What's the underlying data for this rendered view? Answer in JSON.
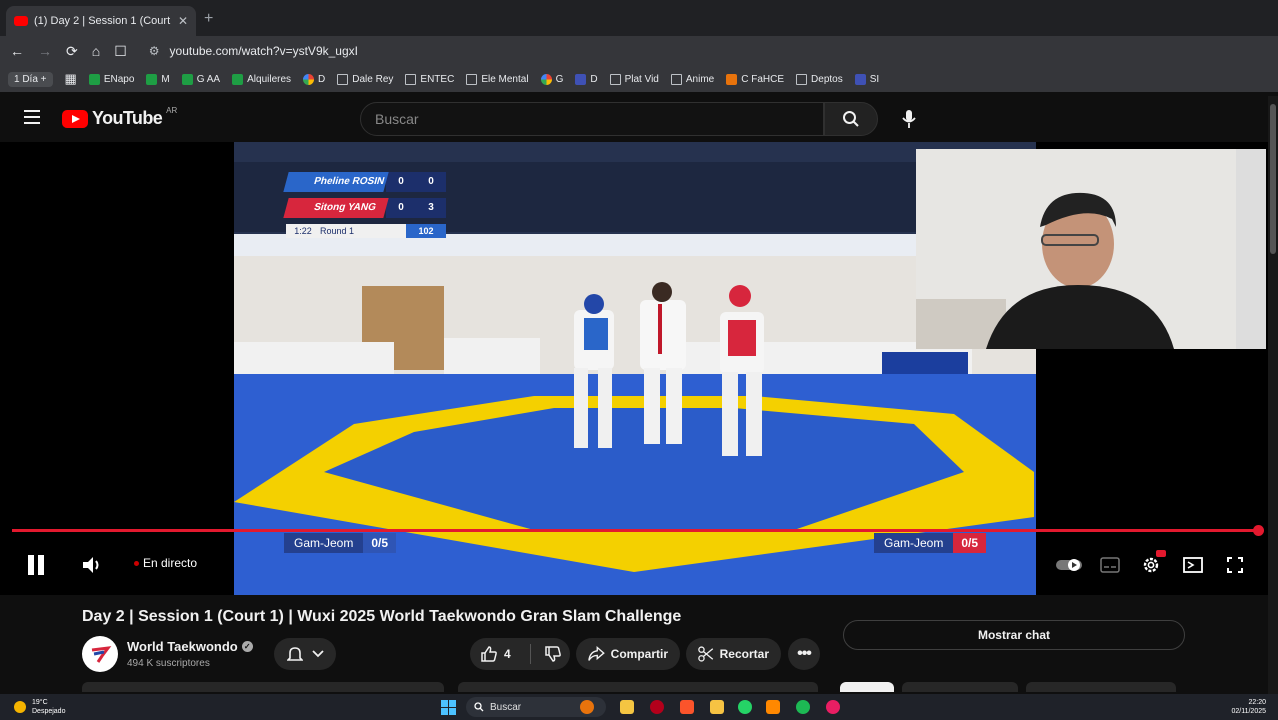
{
  "browser": {
    "tab_title": "(1) Day 2 | Session 1 (Court 1",
    "url": "youtube.com/watch?v=ystV9k_ugxI",
    "bookmarks": [
      "1 Día +",
      "ENapo",
      "M",
      "G AA",
      "Alquileres",
      "D",
      "Dale Rey",
      "ENTEC",
      "Ele Mental",
      "G",
      "D",
      "Plat Vid",
      "Anime",
      "C FaHCE",
      "Deptos",
      "SI"
    ]
  },
  "header": {
    "logo": "YouTube",
    "country": "AR",
    "search_placeholder": "Buscar"
  },
  "player": {
    "scoreboard": {
      "blue_name": "Pheline ROSIN",
      "blue_round_score": "0",
      "blue_score": "0",
      "red_name": "Sitong YANG",
      "red_round_score": "0",
      "red_score": "3",
      "time": "1:22",
      "round_label": "Round",
      "round_num": "1",
      "match_num": "102"
    },
    "gamjeom_left_label": "Gam-Jeom",
    "gamjeom_left_value": "0/5",
    "gamjeom_right_label": "Gam-Jeom",
    "gamjeom_right_value": "0/5",
    "live_label": "En directo",
    "progress": 1.0
  },
  "video_info": {
    "title": "Day 2 | Session 1 (Court 1) | Wuxi 2025 World Taekwondo Gran Slam Challenge",
    "channel": "World Taekwondo",
    "subscribers": "494 K suscriptores",
    "likes": "4",
    "share_label": "Compartir",
    "clip_label": "Recortar",
    "chat_label": "Mostrar chat"
  },
  "taskbar": {
    "temperature": "19°C",
    "weather": "Despejado",
    "search": "Buscar",
    "time": "22:20",
    "date": "02/11/2025"
  },
  "colors": {
    "youtube_red": "#ff0000",
    "progress_red": "#e3192e",
    "blue_athlete": "#2a66c9",
    "red_athlete": "#d7263d"
  }
}
